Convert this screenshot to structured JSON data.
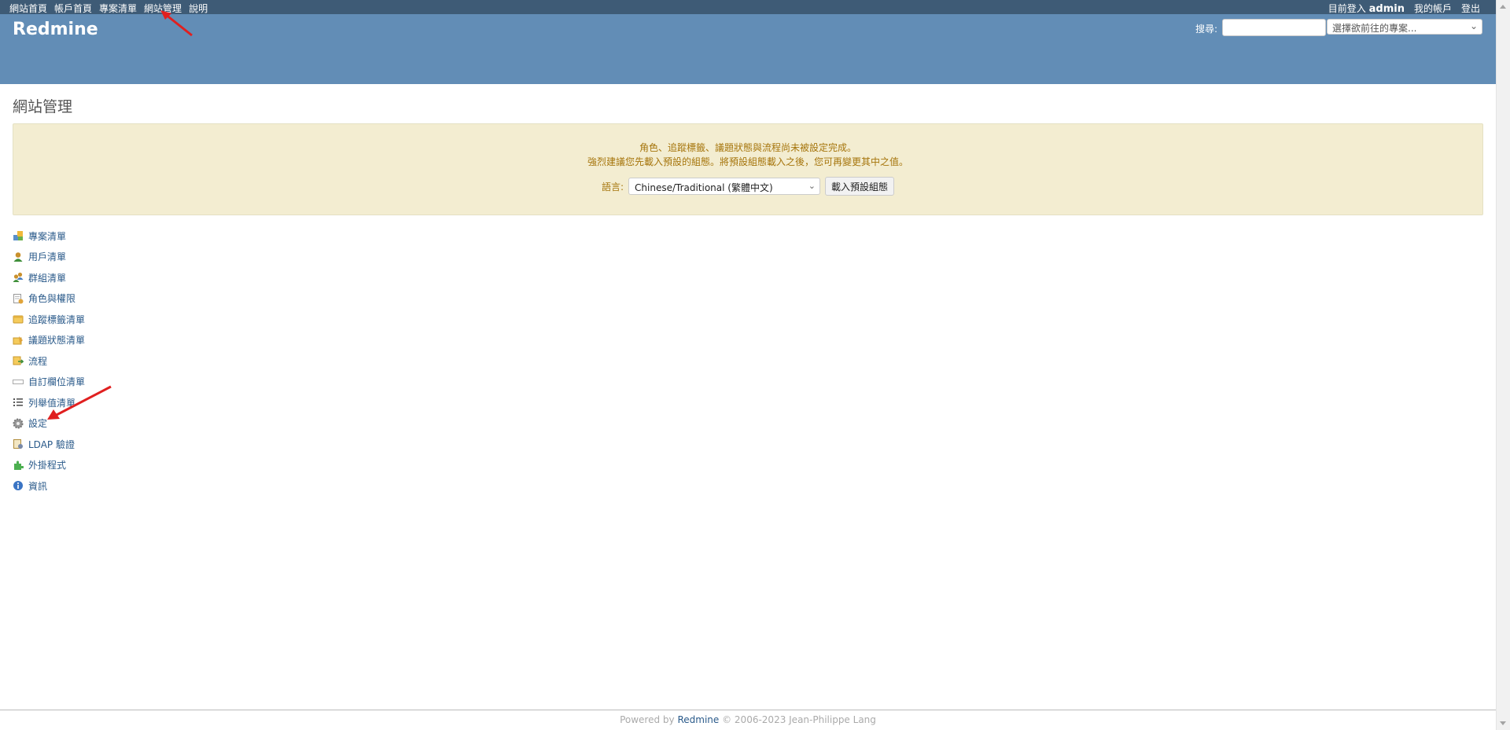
{
  "top_menu": {
    "left_items": [
      "網站首頁",
      "帳戶首頁",
      "專案清單",
      "網站管理",
      "說明"
    ],
    "logged_as_prefix": "目前登入",
    "username": "admin",
    "my_account": "我的帳戶",
    "logout": "登出"
  },
  "header": {
    "title": "Redmine",
    "search_label": "搜尋:",
    "search_value": "",
    "jump_placeholder": "選擇欲前往的專案..."
  },
  "page": {
    "title": "網站管理"
  },
  "warning": {
    "line1": "角色、追蹤標籤、議題狀態與流程尚未被設定完成。",
    "line2": "強烈建議您先載入預設的組態。將預設組態載入之後，您可再變更其中之值。",
    "language_label": "語言:",
    "language_value": "Chinese/Traditional (繁體中文)",
    "load_button": "載入預設組態"
  },
  "admin_menu": {
    "items": [
      {
        "label": "專案清單",
        "icon": "projects-icon"
      },
      {
        "label": "用戶清單",
        "icon": "user-icon"
      },
      {
        "label": "群組清單",
        "icon": "group-icon"
      },
      {
        "label": "角色與權限",
        "icon": "roles-icon"
      },
      {
        "label": "追蹤標籤清單",
        "icon": "tracker-icon"
      },
      {
        "label": "議題狀態清單",
        "icon": "issue-status-icon"
      },
      {
        "label": "流程",
        "icon": "workflow-icon"
      },
      {
        "label": "自訂欄位清單",
        "icon": "custom-field-icon"
      },
      {
        "label": "列舉值清單",
        "icon": "list-icon"
      },
      {
        "label": "設定",
        "icon": "gear-icon"
      },
      {
        "label": "LDAP 驗證",
        "icon": "ldap-icon"
      },
      {
        "label": "外掛程式",
        "icon": "plugin-icon"
      },
      {
        "label": "資訊",
        "icon": "info-icon"
      }
    ]
  },
  "footer": {
    "prefix": "Powered by",
    "link": "Redmine",
    "suffix": "© 2006-2023 Jean-Philippe Lang"
  },
  "colors": {
    "top_bar": "#3e5b76",
    "header": "#628db6",
    "warning_bg": "#f3edd1",
    "warning_text": "#a6750c",
    "link": "#2a5a8a",
    "annotation_arrow": "#e02020"
  }
}
